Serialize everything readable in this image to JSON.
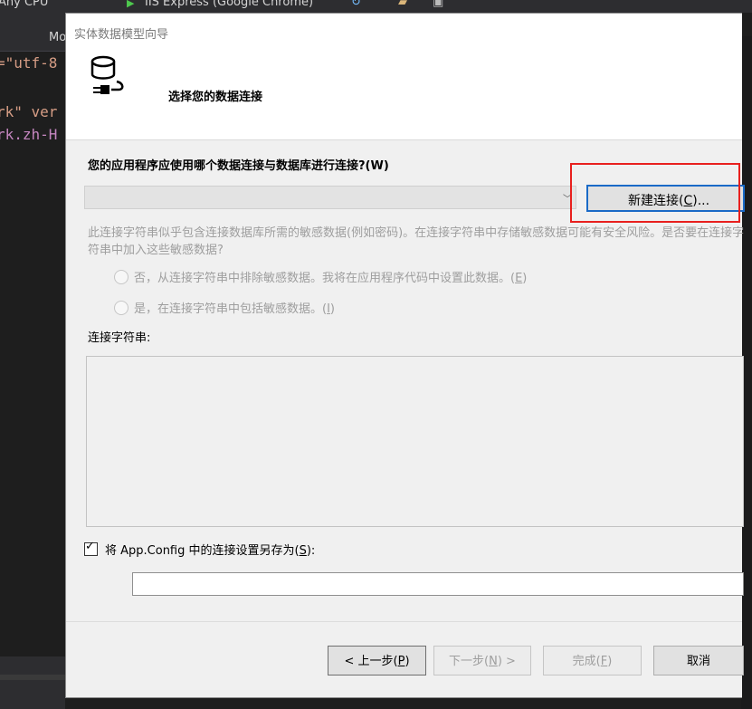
{
  "background": {
    "toolbar": {
      "platform": "Any CPU",
      "run_target": "IIS Express (Google Chrome)"
    },
    "tab": "Mo",
    "code_lines": [
      {
        "text": "=\"utf-8",
        "color": "#d69d85"
      },
      {
        "text": "rk\" ver",
        "color": "#d69d85"
      },
      {
        "text": "rk.zh-H",
        "color": "#c586c0"
      }
    ]
  },
  "dialog": {
    "title": "实体数据模型向导",
    "header_title": "选择您的数据连接",
    "question": "您的应用程序应使用哪个数据连接与数据库进行连接?(W)",
    "connection_select": {
      "value": ""
    },
    "new_connection_button": {
      "text": "新建连接(",
      "key": "C",
      "suffix": ")..."
    },
    "sensitive_text": "此连接字符串似乎包含连接数据库所需的敏感数据(例如密码)。在连接字符串中存储敏感数据可能有安全风险。是否要在连接字符串中加入这些敏感数据?",
    "radio_exclude": {
      "text": "否，从连接字符串中排除敏感数据。我将在应用程序代码中设置此数据。(",
      "key": "E",
      "suffix": ")"
    },
    "radio_include": {
      "text": "是，在连接字符串中包括敏感数据。(",
      "key": "I",
      "suffix": ")"
    },
    "connection_string_label": "连接字符串:",
    "connection_string_value": "",
    "save_checkbox": {
      "checked": true,
      "mark": "✓",
      "text": "将 App.Config 中的连接设置另存为(",
      "key": "S",
      "suffix": "):"
    },
    "save_name_value": "",
    "buttons": {
      "prev": {
        "text": "< 上一步(",
        "key": "P",
        "suffix": ")"
      },
      "next": {
        "text": "下一步(",
        "key": "N",
        "suffix": ") >"
      },
      "finish": {
        "text": "完成(",
        "key": "F",
        "suffix": ")"
      },
      "cancel": {
        "text": "取消"
      }
    }
  },
  "colors": {
    "highlight_box": "#e8201e",
    "focus_border": "#1a6ac7",
    "disabled_text": "#9e9e9e"
  }
}
